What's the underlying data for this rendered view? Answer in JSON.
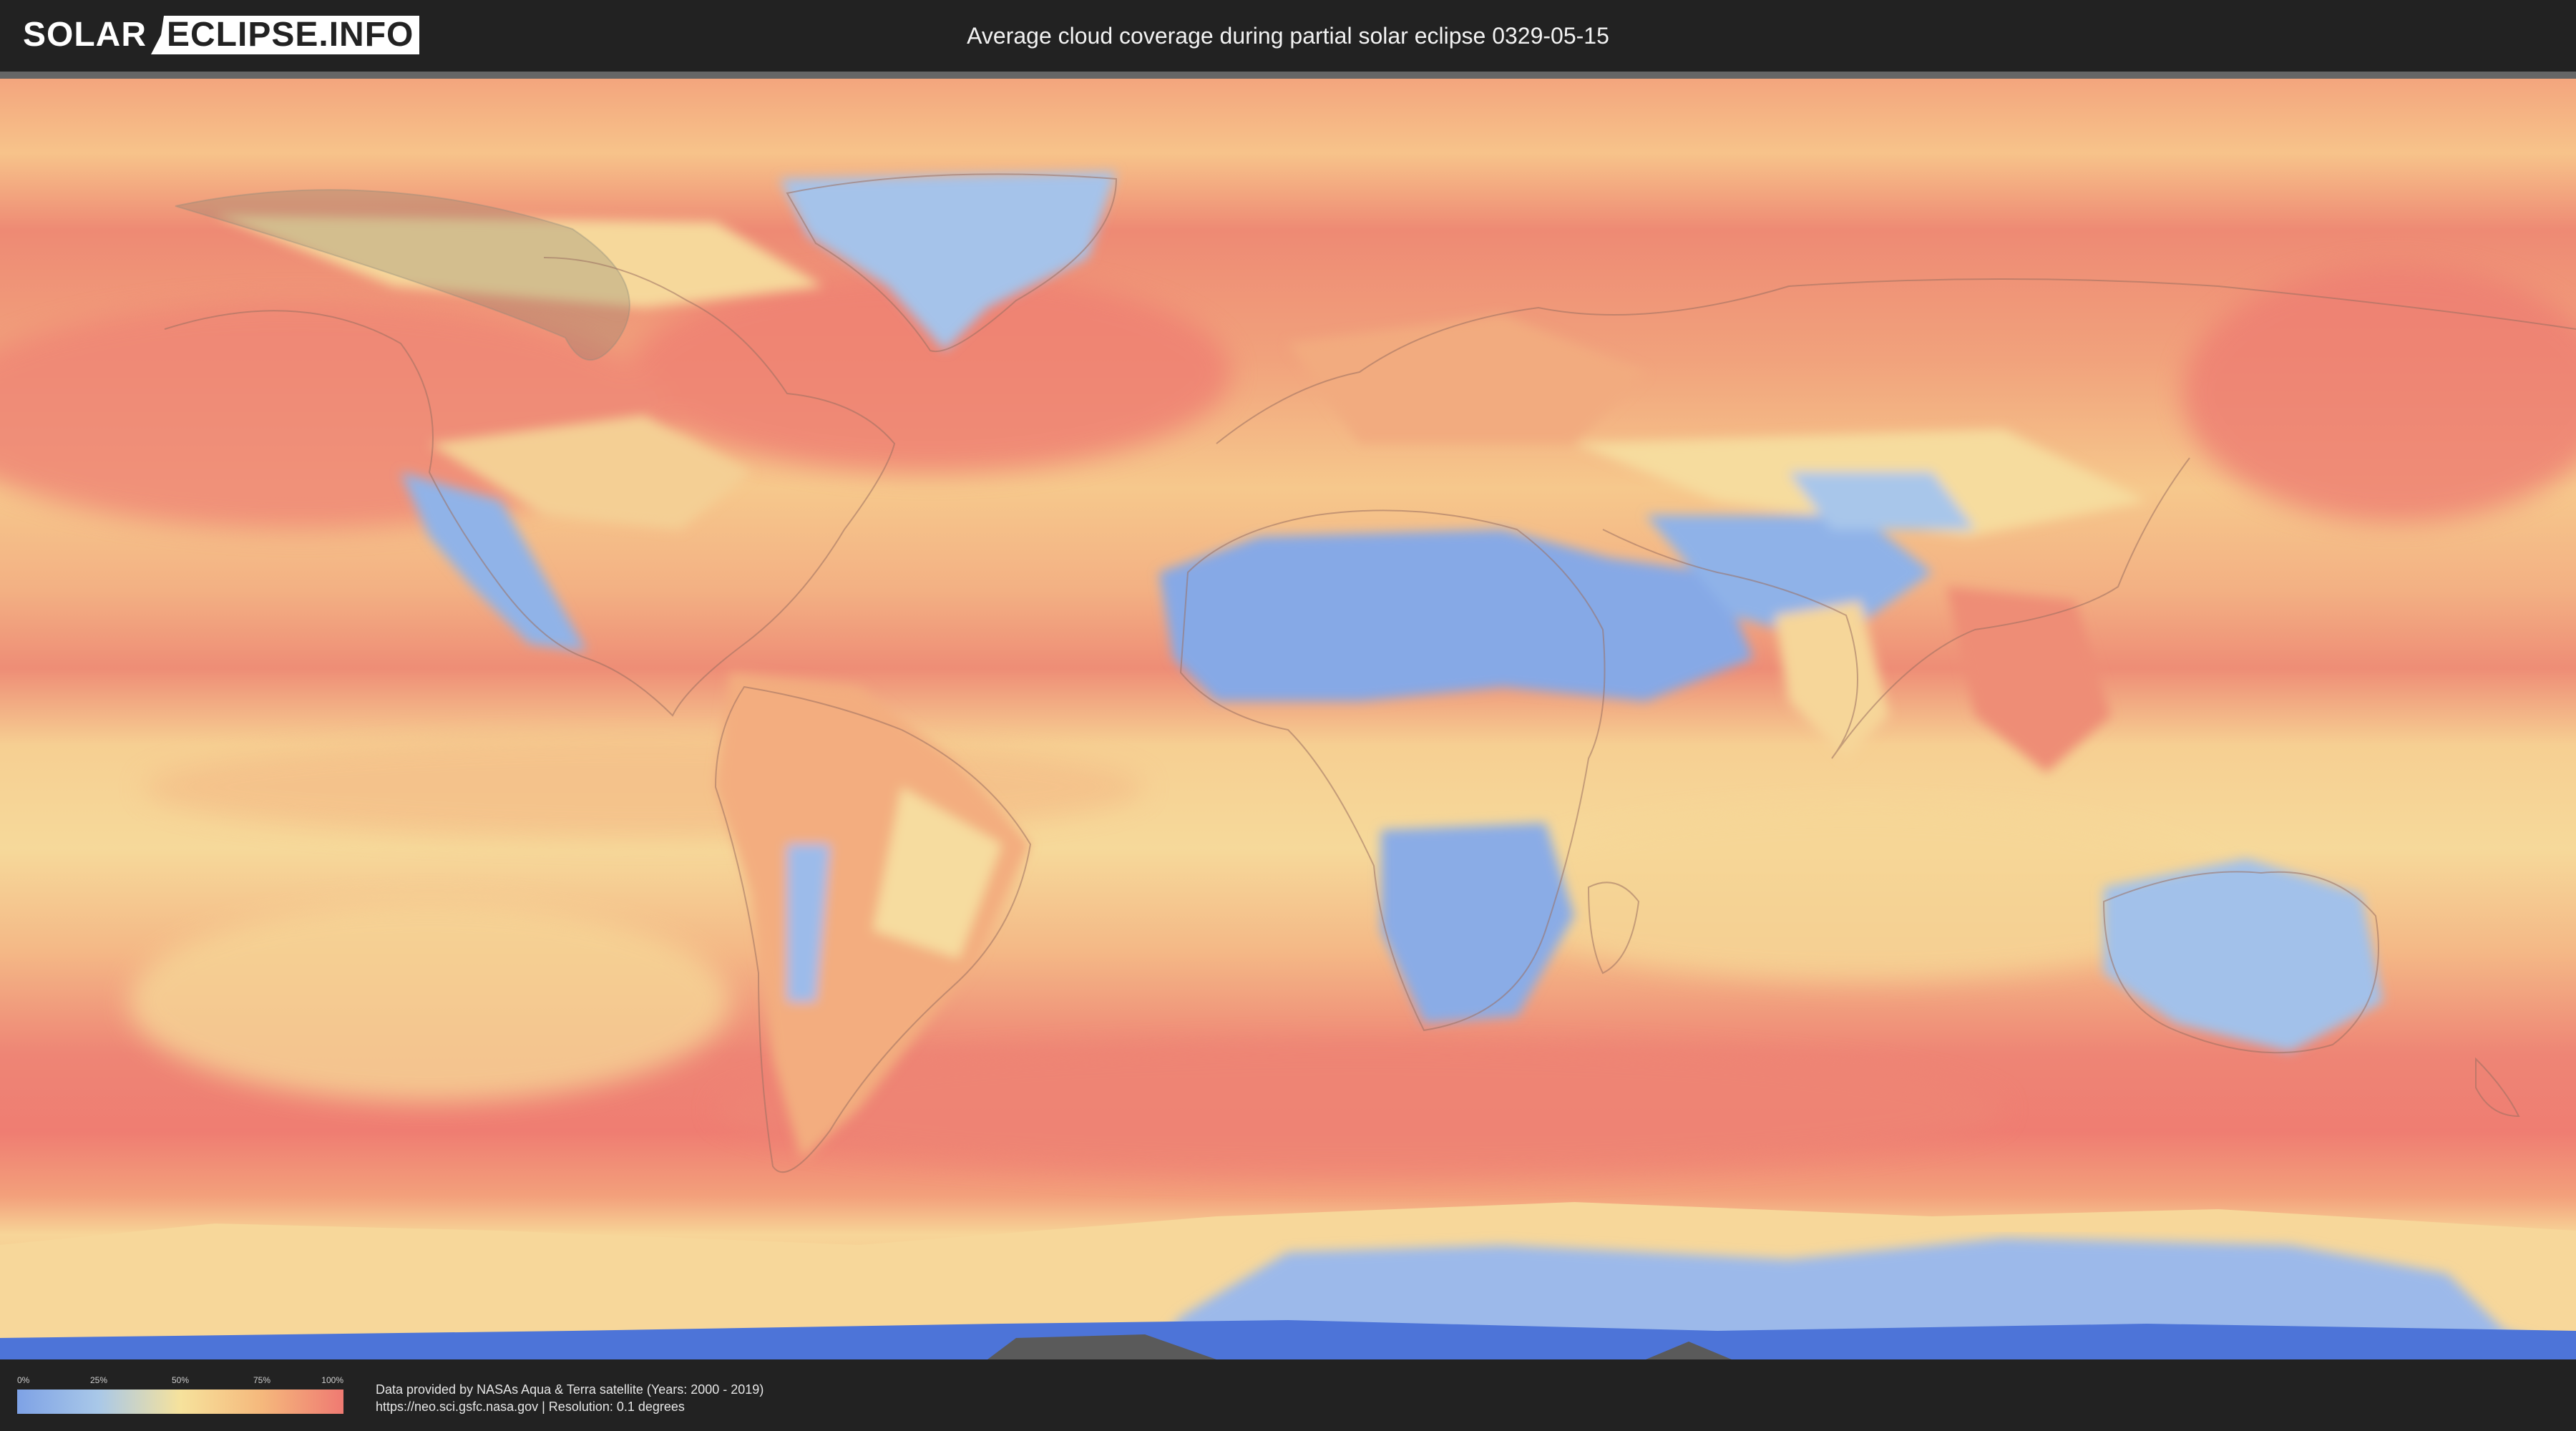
{
  "header": {
    "logo_left": "SOLAR",
    "logo_right": "ECLIPSE.INFO",
    "title": "Average cloud coverage during partial solar eclipse 0329-05-15"
  },
  "map": {
    "kind": "world cloud coverage heatmap",
    "colors": {
      "ocean_high": "#ef7a72",
      "mid": "#f6c886",
      "low": "#f6e29c",
      "clear": "#8fb2e6",
      "antarctic": "#4d74d8",
      "border": "#9a7060"
    }
  },
  "legend": {
    "ticks": [
      "0%",
      "25%",
      "50%",
      "75%",
      "100%"
    ]
  },
  "footer": {
    "credit_line1": "Data provided by NASAs Aqua & Terra satellite (Years: 2000 - 2019)",
    "credit_line2": "https://neo.sci.gsfc.nasa.gov | Resolution: 0.1 degrees"
  }
}
